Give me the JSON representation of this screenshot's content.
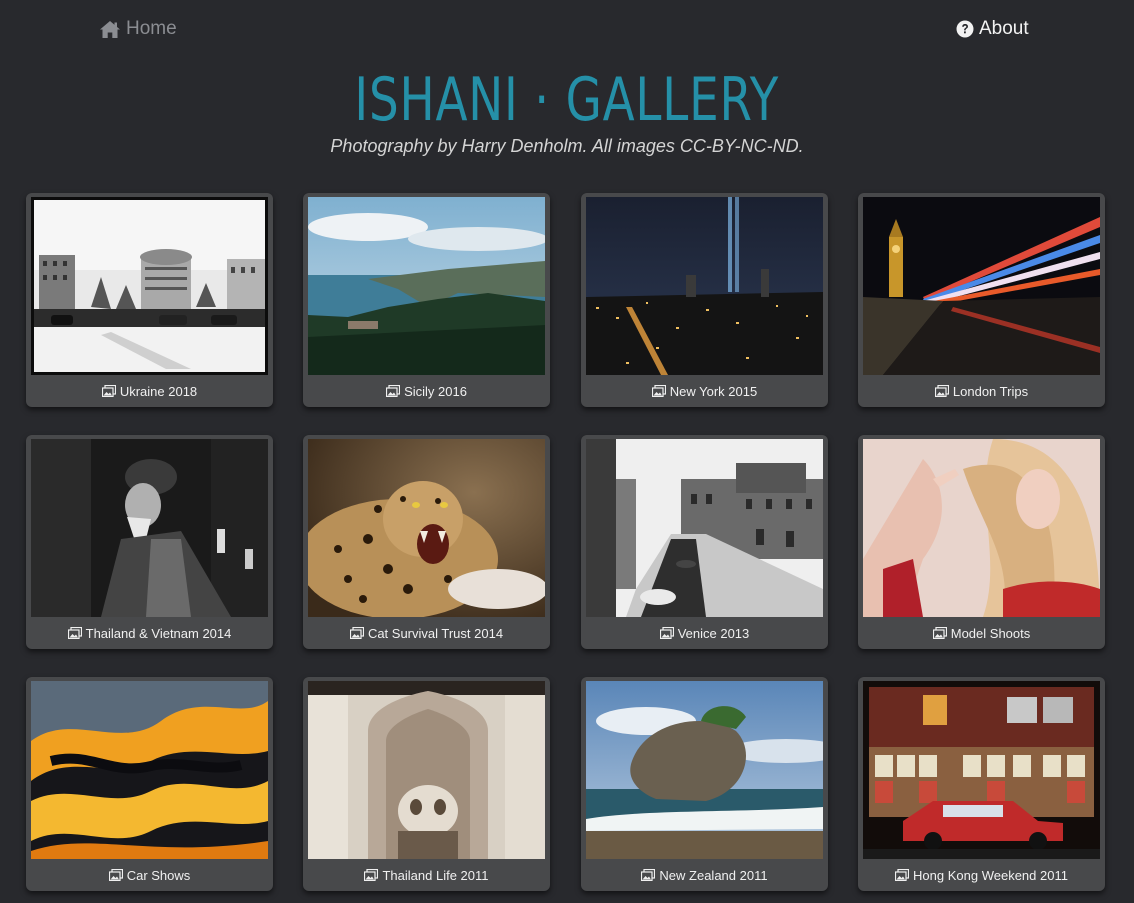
{
  "nav": {
    "home_label": "Home",
    "home_icon": "home-icon",
    "about_label": "About",
    "about_icon": "question-circle-icon"
  },
  "header": {
    "title": "ISHANI · GALLERY",
    "subtitle": "Photography by Harry Denholm. All images CC-BY-NC-ND."
  },
  "colors": {
    "background": "#28292d",
    "accent": "#2590a8",
    "card": "#48494b",
    "nav_inactive": "#8b8d92"
  },
  "gallery": {
    "caption_icon": "images-icon",
    "albums": [
      {
        "title": "Ukraine 2018"
      },
      {
        "title": "Sicily 2016"
      },
      {
        "title": "New York 2015"
      },
      {
        "title": "London Trips"
      },
      {
        "title": "Thailand & Vietnam 2014"
      },
      {
        "title": "Cat Survival Trust 2014"
      },
      {
        "title": "Venice 2013"
      },
      {
        "title": "Model Shoots"
      },
      {
        "title": "Car Shows"
      },
      {
        "title": "Thailand Life 2011"
      },
      {
        "title": "New Zealand 2011"
      },
      {
        "title": "Hong Kong Weekend 2011"
      }
    ]
  }
}
